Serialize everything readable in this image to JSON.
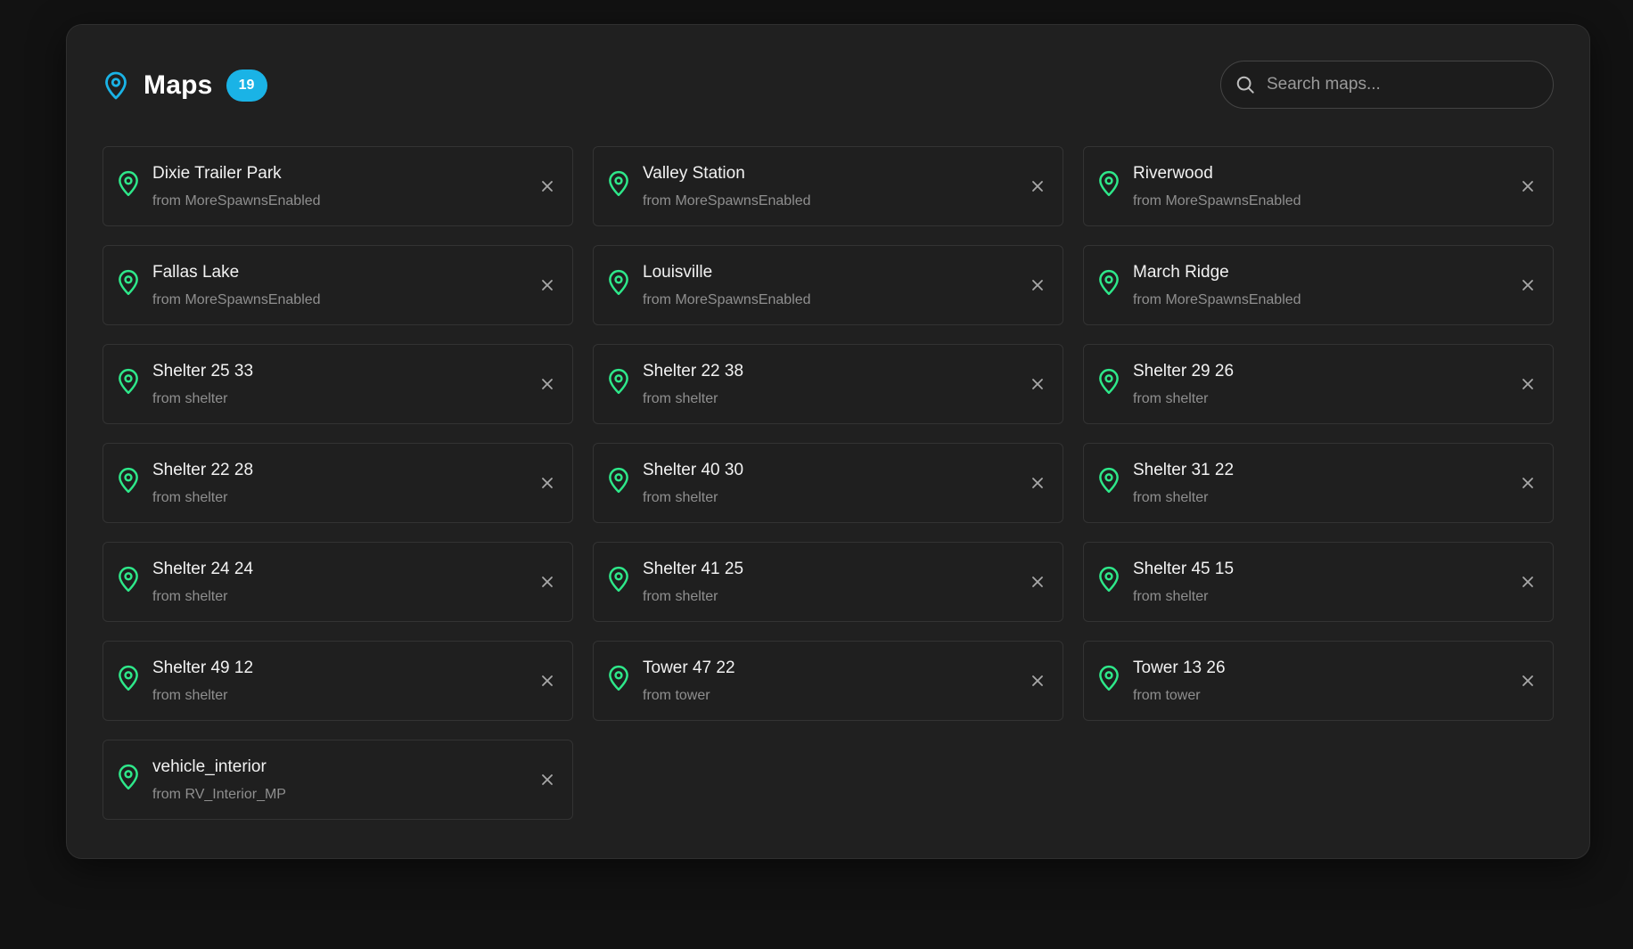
{
  "header": {
    "title": "Maps",
    "count": "19",
    "title_icon": "map-pin-icon",
    "accent_color": "#1ab3e6"
  },
  "search": {
    "placeholder": "Search maps...",
    "value": "",
    "icon": "search-icon"
  },
  "item_icon": "map-pin-icon",
  "item_icon_color": "#2ee88a",
  "remove_icon": "close-icon",
  "maps": [
    {
      "name": "Dixie Trailer Park",
      "source": "from MoreSpawnsEnabled"
    },
    {
      "name": "Valley Station",
      "source": "from MoreSpawnsEnabled"
    },
    {
      "name": "Riverwood",
      "source": "from MoreSpawnsEnabled"
    },
    {
      "name": "Fallas Lake",
      "source": "from MoreSpawnsEnabled"
    },
    {
      "name": "Louisville",
      "source": "from MoreSpawnsEnabled"
    },
    {
      "name": "March Ridge",
      "source": "from MoreSpawnsEnabled"
    },
    {
      "name": "Shelter 25 33",
      "source": "from shelter"
    },
    {
      "name": "Shelter 22 38",
      "source": "from shelter"
    },
    {
      "name": "Shelter 29 26",
      "source": "from shelter"
    },
    {
      "name": "Shelter 22 28",
      "source": "from shelter"
    },
    {
      "name": "Shelter 40 30",
      "source": "from shelter"
    },
    {
      "name": "Shelter 31 22",
      "source": "from shelter"
    },
    {
      "name": "Shelter 24 24",
      "source": "from shelter"
    },
    {
      "name": "Shelter 41 25",
      "source": "from shelter"
    },
    {
      "name": "Shelter 45 15",
      "source": "from shelter"
    },
    {
      "name": "Shelter 49 12",
      "source": "from shelter"
    },
    {
      "name": "Tower 47 22",
      "source": "from tower"
    },
    {
      "name": "Tower 13 26",
      "source": "from tower"
    },
    {
      "name": "vehicle_interior",
      "source": "from RV_Interior_MP"
    }
  ]
}
